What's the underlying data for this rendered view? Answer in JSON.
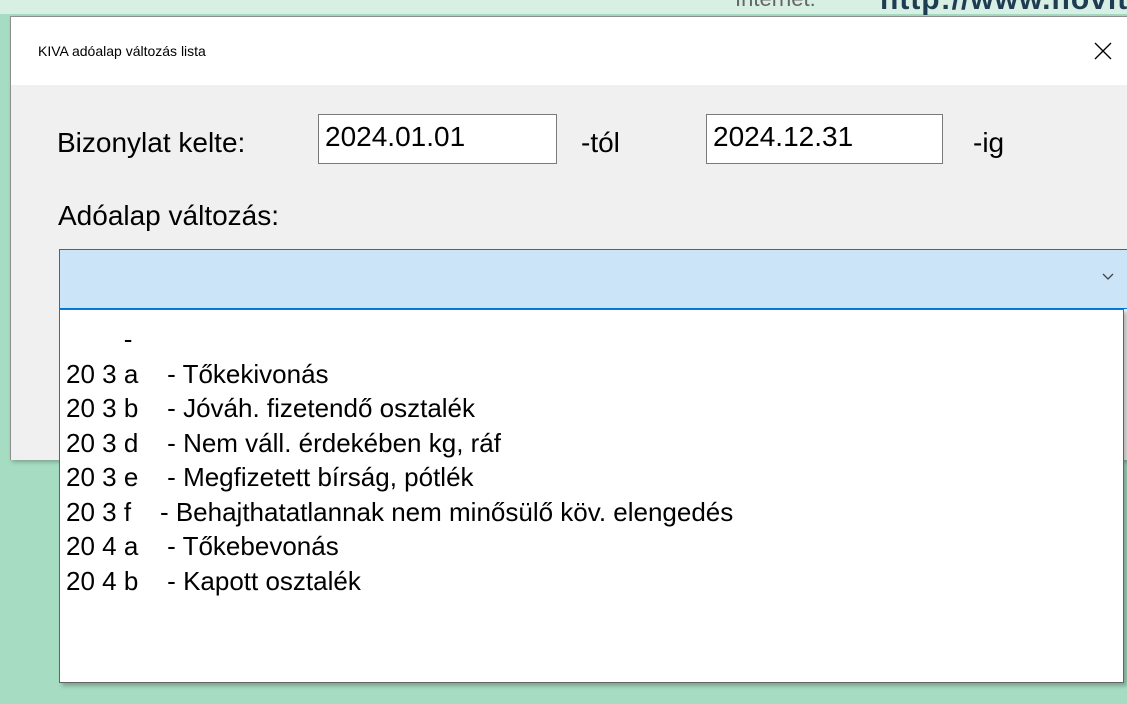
{
  "background": {
    "internet_label": "Internet:",
    "url_text": "http://www.novit"
  },
  "dialog": {
    "title": "KIVA adóalap változás lista",
    "close_glyph": "✕",
    "date_label": "Bizonylat kelte:",
    "date_from": "2024.01.01",
    "from_suffix": "-tól",
    "date_to": "2024.12.31",
    "to_suffix": "-ig",
    "change_label": "Adóalap változás:",
    "combo_value": "",
    "dropdown_items": [
      "        -",
      "20 3 a    - Tőkekivonás",
      "20 3 b    - Jóváh. fizetendő osztalék",
      "20 3 d    - Nem váll. érdekében kg, ráf",
      "20 3 e    - Megfizetett bírság, pótlék",
      "20 3 f    - Behajthatatlannak nem minősülő köv. elengedés",
      "20 4 a    - Tőkebevonás",
      "20 4 b    - Kapott osztalék"
    ]
  },
  "colors": {
    "desktop_bg": "#a6dcc2",
    "combo_highlight": "#cce4f7",
    "focus_border": "#0078d7"
  }
}
